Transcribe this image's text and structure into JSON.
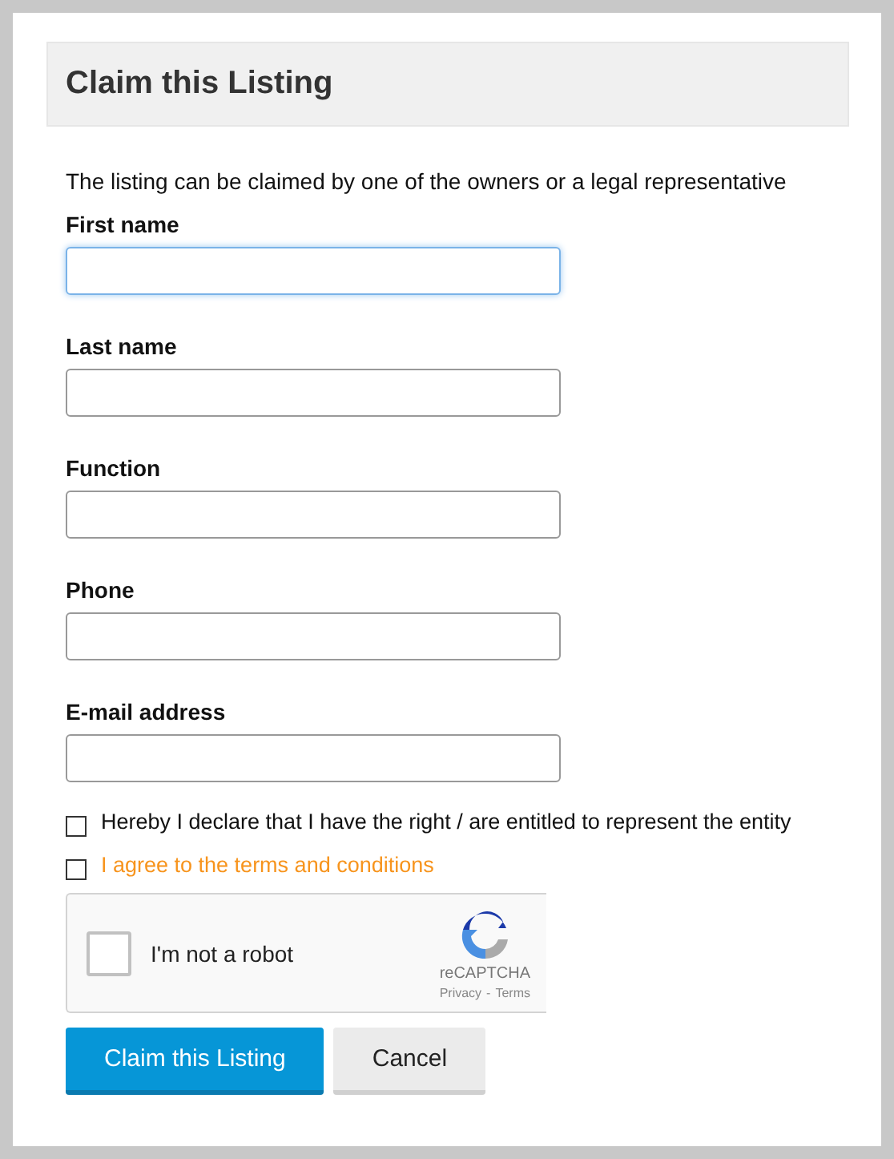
{
  "dialog": {
    "title": "Claim this Listing"
  },
  "intro": "The listing can be claimed by one of the owners or a legal representative",
  "fields": [
    {
      "label": "First name",
      "focused": true
    },
    {
      "label": "Last name",
      "focused": false
    },
    {
      "label": "Function",
      "focused": false
    },
    {
      "label": "Phone",
      "focused": false
    },
    {
      "label": "E-mail address",
      "focused": false
    }
  ],
  "checkboxes": [
    {
      "label": "Hereby I declare that I have the right / are entitled to represent the entity",
      "checked": false,
      "kind": "text"
    },
    {
      "label": "I agree to the terms and conditions",
      "checked": false,
      "kind": "link"
    }
  ],
  "captcha": {
    "label": "I'm not a robot",
    "checked": false,
    "brand": "reCAPTCHA",
    "privacy": "Privacy",
    "separator": "-",
    "terms": "Terms"
  },
  "buttons": [
    {
      "label": "Claim this Listing",
      "kind": "primary"
    },
    {
      "label": "Cancel",
      "kind": "secondary"
    }
  ]
}
